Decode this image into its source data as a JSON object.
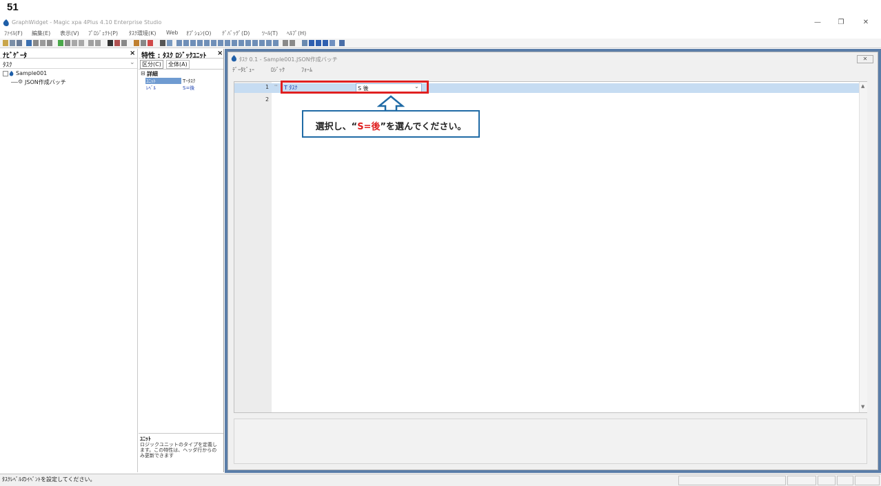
{
  "slide": {
    "number": "51"
  },
  "window": {
    "title": "GraphWidget - Magic xpa 4Plus 4.10 Enterprise Studio",
    "controls": {
      "minimize": "—",
      "restore": "❐",
      "close": "✕"
    }
  },
  "menu": [
    "ﾌｧｲﾙ(F)",
    "編集(E)",
    "表示(V)",
    "ﾌﾟﾛｼﾞｪｸﾄ(P)",
    "ﾀｽｸ環境(K)",
    "Web",
    "ｵﾌﾟｼｮﾝ(O)",
    "ﾃﾞﾊﾞｯｸﾞ(D)",
    "ﾂｰﾙ(T)",
    "ﾍﾙﾌﾟ(H)"
  ],
  "navigator": {
    "title": "ﾅﾋﾞｹﾞｰﾀ",
    "close": "×",
    "dropdown_value": "ﾀｽｸ",
    "tree": {
      "root": "Sample001",
      "child": "JSON作成バッチ"
    }
  },
  "properties": {
    "title": "特性 : ﾀｽｸ ﾛｼﾞｯｸﾕﾆｯﾄ",
    "close": "×",
    "tabs": [
      "区分(C)",
      "全体(A)"
    ],
    "section": "詳細",
    "rows": [
      {
        "label": "ﾕﾆｯﾄ",
        "value": "Tｰﾀｽｸ"
      },
      {
        "label": "ﾚﾍﾞﾙ",
        "value": "S=後"
      }
    ],
    "help_title": "ﾕﾆｯﾄ",
    "help_text": "ロジックユニットのタイプを定義します。この特性は、ヘッダ行からのみ更新できます"
  },
  "editor": {
    "title": "ﾀｽｸ 0.1 -  Sample001.JSON作成バッチ",
    "close": "✕",
    "tabs": [
      "ﾃﾞｰﾀﾋﾞｭｰ",
      "ﾛｼﾞｯｸ",
      "ﾌｫｰﾑ"
    ],
    "lines": [
      {
        "num": "1",
        "unit": "T ﾀｽｸ",
        "level": "S 後"
      },
      {
        "num": "2"
      }
    ]
  },
  "callout": {
    "before": "選択し、“",
    "highlight": "S=後",
    "after": "”を選んでください。"
  },
  "status": {
    "message": "ﾀｽｸﾚﾍﾞﾙのｲﾍﾞﾝﾄを設定してください。"
  },
  "colors": {
    "accent_blue": "#1f6aa5",
    "highlight_red": "#e02020",
    "selected_row": "#c6dcf2"
  }
}
